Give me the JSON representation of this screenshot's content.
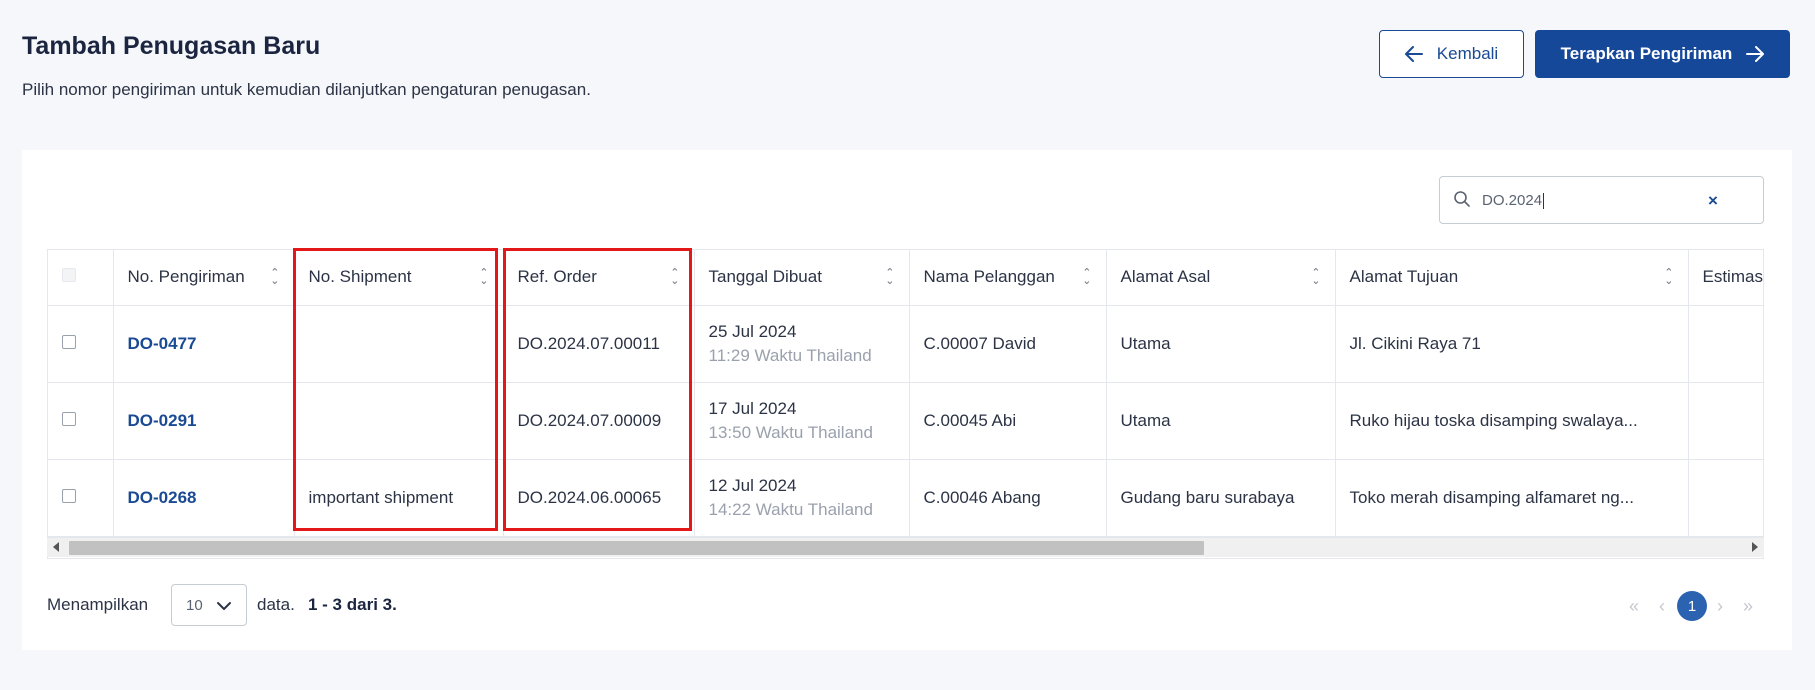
{
  "header": {
    "title": "Tambah Penugasan Baru",
    "subtitle": "Pilih nomor pengiriman untuk kemudian dilanjutkan pengaturan penugasan.",
    "back_label": "Kembali",
    "apply_label": "Terapkan Pengiriman"
  },
  "search": {
    "value": "DO.2024",
    "clear_icon": "close-icon"
  },
  "table": {
    "columns": [
      "No. Pengiriman",
      "No. Shipment",
      "Ref. Order",
      "Tanggal Dibuat",
      "Nama Pelanggan",
      "Alamat Asal",
      "Alamat Tujuan",
      "Estimas"
    ],
    "rows": [
      {
        "no_pengiriman": "DO-0477",
        "no_shipment": "",
        "ref_order": "DO.2024.07.00011",
        "tanggal": "25 Jul 2024",
        "waktu": "11:29 Waktu Thailand",
        "pelanggan": "C.00007 David",
        "asal": "Utama",
        "tujuan": "Jl. Cikini Raya 71",
        "estimasi": ""
      },
      {
        "no_pengiriman": "DO-0291",
        "no_shipment": "",
        "ref_order": "DO.2024.07.00009",
        "tanggal": "17 Jul 2024",
        "waktu": "13:50 Waktu Thailand",
        "pelanggan": "C.00045 Abi",
        "asal": "Utama",
        "tujuan": "Ruko hijau toska disamping swalaya...",
        "estimasi": ""
      },
      {
        "no_pengiriman": "DO-0268",
        "no_shipment": "important shipment",
        "ref_order": "DO.2024.06.00065",
        "tanggal": "12 Jul 2024",
        "waktu": "14:22 Waktu Thailand",
        "pelanggan": "C.00046 Abang",
        "asal": "Gudang baru surabaya",
        "tujuan": "Toko merah disamping alfamaret ng...",
        "estimasi": ""
      }
    ]
  },
  "footer": {
    "show_label": "Menampilkan",
    "page_size": "10",
    "data_label": "data.",
    "range_text": "1 - 3 dari 3.",
    "pager": {
      "first": "«",
      "prev": "‹",
      "current": "1",
      "next": "›",
      "last": "»"
    }
  },
  "colors": {
    "primary": "#16489a",
    "highlight": "#e31818",
    "link": "#1a4a93"
  }
}
